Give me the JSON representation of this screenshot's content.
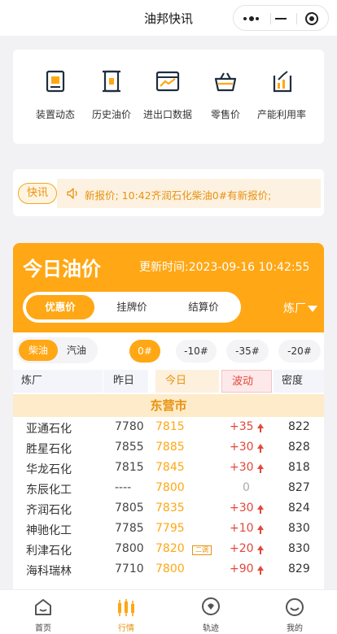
{
  "header": {
    "title": "油邦快讯"
  },
  "quick_links": [
    {
      "label": "装置动态",
      "icon": "device-doc-icon"
    },
    {
      "label": "历史油价",
      "icon": "oil-barrel-icon"
    },
    {
      "label": "进出口数据",
      "icon": "chart-window-icon"
    },
    {
      "label": "零售价",
      "icon": "basket-icon"
    },
    {
      "label": "产能利用率",
      "icon": "trend-chart-icon"
    }
  ],
  "news": {
    "tag": "快讯",
    "text": "新报价; 10:42齐润石化柴油0#有新报价;"
  },
  "price": {
    "title": "今日油价",
    "updated": "更新时间:2023-09-16 10:42:55",
    "tabs": [
      "优惠价",
      "挂牌价",
      "结算价"
    ],
    "active_tab": "优惠价",
    "refinery_filter": "炼厂",
    "fuel_types": [
      "柴油",
      "汽油"
    ],
    "active_fuel": "柴油",
    "grades": [
      "0#",
      "-10#",
      "-35#",
      "-20#"
    ],
    "active_grade": "0#",
    "columns": [
      "炼厂",
      "昨日",
      "今日",
      "波动",
      "密度"
    ],
    "city": "东营市",
    "rows": [
      {
        "name": "亚通石化",
        "yesterday": "7780",
        "today": "7815",
        "badge": "",
        "change": "+35",
        "up": true,
        "density": "822"
      },
      {
        "name": "胜星石化",
        "yesterday": "7855",
        "today": "7885",
        "badge": "",
        "change": "+30",
        "up": true,
        "density": "828"
      },
      {
        "name": "华龙石化",
        "yesterday": "7815",
        "today": "7845",
        "badge": "",
        "change": "+30",
        "up": true,
        "density": "818"
      },
      {
        "name": "东辰化工",
        "yesterday": "----",
        "today": "7800",
        "badge": "",
        "change": "0",
        "up": false,
        "density": "827"
      },
      {
        "name": "齐润石化",
        "yesterday": "7805",
        "today": "7835",
        "badge": "",
        "change": "+30",
        "up": true,
        "density": "824"
      },
      {
        "name": "神驰化工",
        "yesterday": "7785",
        "today": "7795",
        "badge": "",
        "change": "+10",
        "up": true,
        "density": "830"
      },
      {
        "name": "利津石化",
        "yesterday": "7800",
        "today": "7820",
        "badge": "二调",
        "change": "+20",
        "up": true,
        "density": "830"
      },
      {
        "name": "海科瑞林",
        "yesterday": "7710",
        "today": "7800",
        "badge": "",
        "change": "+90",
        "up": true,
        "density": "829"
      }
    ]
  },
  "tabbar": [
    {
      "label": "首页",
      "icon": "home-icon"
    },
    {
      "label": "行情",
      "icon": "candlestick-icon"
    },
    {
      "label": "轨迹",
      "icon": "chat-bubble-icon"
    },
    {
      "label": "我的",
      "icon": "smiley-icon"
    }
  ],
  "tabbar_active": "行情",
  "colors": {
    "accent": "#ffa714",
    "up": "#e2483b"
  }
}
